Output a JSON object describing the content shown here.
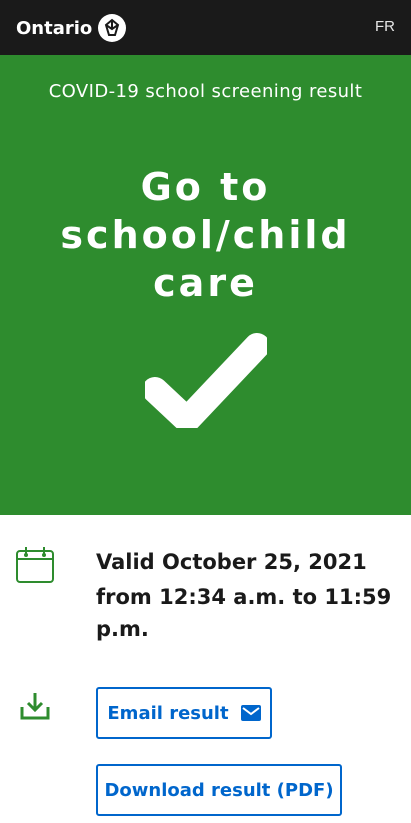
{
  "header": {
    "logo_text": "Ontario",
    "logo_icon": "trillium-icon",
    "language_link": "FR"
  },
  "result": {
    "label": "COVID-19 school screening result",
    "headline_line1": "Go to",
    "headline_line2": "school/child",
    "headline_line3": "care",
    "status_icon": "checkmark-icon",
    "background_color": "#2e8c2e"
  },
  "validity": {
    "icon": "calendar-icon",
    "date_text": "Valid October 25, 2021",
    "time_text": "from 12:34 a.m. to 11:59 p.m."
  },
  "actions": {
    "icon": "download-icon",
    "email_label": "Email result",
    "email_icon": "mail-icon",
    "download_label": "Download result (PDF)",
    "accent_color": "#0066cc"
  }
}
